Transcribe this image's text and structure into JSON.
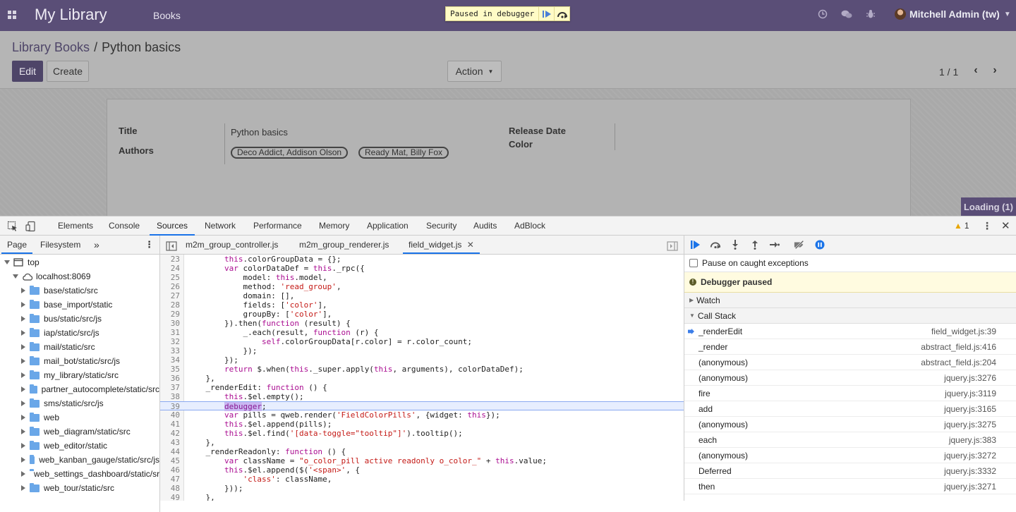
{
  "odoo": {
    "app_title": "My Library",
    "menu_books": "Books",
    "paused_banner": "Paused in debugger",
    "user_name": "Mitchell Admin (tw)",
    "breadcrumb_parent": "Library Books",
    "breadcrumb_sep": "/",
    "breadcrumb_current": "Python basics",
    "edit_label": "Edit",
    "create_label": "Create",
    "action_label": "Action",
    "pager": "1 / 1",
    "form": {
      "title_label": "Title",
      "title_value": "Python basics",
      "authors_label": "Authors",
      "authors": [
        "Deco Addict, Addison Olson",
        "Ready Mat, Billy Fox"
      ],
      "release_date_label": "Release Date",
      "color_label": "Color"
    },
    "loading": "Loading (1)",
    "accent_color": "#5a4e77"
  },
  "devtools": {
    "tabs": [
      "Elements",
      "Console",
      "Sources",
      "Network",
      "Performance",
      "Memory",
      "Application",
      "Security",
      "Audits",
      "AdBlock"
    ],
    "active_tab": "Sources",
    "warning_count": "1",
    "navigator_tabs": [
      "Page",
      "Filesystem"
    ],
    "tree": {
      "top": "top",
      "host": "localhost:8069",
      "folders": [
        "base/static/src",
        "base_import/static",
        "bus/static/src/js",
        "iap/static/src/js",
        "mail/static/src",
        "mail_bot/static/src/js",
        "my_library/static/src",
        "partner_autocomplete/static/src",
        "sms/static/src/js",
        "web",
        "web_diagram/static/src",
        "web_editor/static",
        "web_kanban_gauge/static/src/js",
        "web_settings_dashboard/static/src",
        "web_tour/static/src"
      ]
    },
    "editor_tabs": [
      "m2m_group_controller.js",
      "m2m_group_renderer.js",
      "field_widget.js"
    ],
    "active_editor_tab": "field_widget.js",
    "highlighted_line": "39",
    "code_lines": [
      {
        "n": "23",
        "t": "        this.colorGroupData = {};"
      },
      {
        "n": "24",
        "t": "        var colorDataDef = this._rpc({"
      },
      {
        "n": "25",
        "t": "            model: this.model,"
      },
      {
        "n": "26",
        "t": "            method: 'read_group',"
      },
      {
        "n": "27",
        "t": "            domain: [],"
      },
      {
        "n": "28",
        "t": "            fields: ['color'],"
      },
      {
        "n": "29",
        "t": "            groupBy: ['color'],"
      },
      {
        "n": "30",
        "t": "        }).then(function (result) {"
      },
      {
        "n": "31",
        "t": "            _.each(result, function (r) {"
      },
      {
        "n": "32",
        "t": "                self.colorGroupData[r.color] = r.color_count;"
      },
      {
        "n": "33",
        "t": "            });"
      },
      {
        "n": "34",
        "t": "        });"
      },
      {
        "n": "35",
        "t": "        return $.when(this._super.apply(this, arguments), colorDataDef);"
      },
      {
        "n": "36",
        "t": "    },"
      },
      {
        "n": "37",
        "t": "    _renderEdit: function () {"
      },
      {
        "n": "38",
        "t": "        this.$el.empty();"
      },
      {
        "n": "39",
        "t": "        debugger;"
      },
      {
        "n": "40",
        "t": "        var pills = qweb.render('FieldColorPills', {widget: this});"
      },
      {
        "n": "41",
        "t": "        this.$el.append(pills);"
      },
      {
        "n": "42",
        "t": "        this.$el.find('[data-toggle=\"tooltip\"]').tooltip();"
      },
      {
        "n": "43",
        "t": "    },"
      },
      {
        "n": "44",
        "t": "    _renderReadonly: function () {"
      },
      {
        "n": "45",
        "t": "        var className = \"o_color_pill active readonly o_color_\" + this.value;"
      },
      {
        "n": "46",
        "t": "        this.$el.append($('<span>', {"
      },
      {
        "n": "47",
        "t": "            'class': className,"
      },
      {
        "n": "48",
        "t": "        }));"
      },
      {
        "n": "49",
        "t": "    },"
      }
    ],
    "pause_caught": "Pause on caught exceptions",
    "debugger_paused": "Debugger paused",
    "watch_label": "Watch",
    "call_stack_label": "Call Stack",
    "call_stack": [
      {
        "fn": "_renderEdit",
        "loc": "field_widget.js:39"
      },
      {
        "fn": "_render",
        "loc": "abstract_field.js:416"
      },
      {
        "fn": "(anonymous)",
        "loc": "abstract_field.js:204"
      },
      {
        "fn": "(anonymous)",
        "loc": "jquery.js:3276"
      },
      {
        "fn": "fire",
        "loc": "jquery.js:3119"
      },
      {
        "fn": "add",
        "loc": "jquery.js:3165"
      },
      {
        "fn": "(anonymous)",
        "loc": "jquery.js:3275"
      },
      {
        "fn": "each",
        "loc": "jquery.js:383"
      },
      {
        "fn": "(anonymous)",
        "loc": "jquery.js:3272"
      },
      {
        "fn": "Deferred",
        "loc": "jquery.js:3332"
      },
      {
        "fn": "then",
        "loc": "jquery.js:3271"
      }
    ]
  }
}
